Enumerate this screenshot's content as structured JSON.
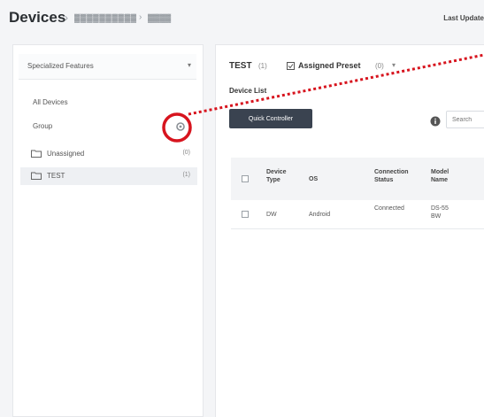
{
  "header": {
    "title": "Devices",
    "separator": "›",
    "breadcrumb": [
      "▓▓▓▓▓▓▓▓▓▓",
      "▓▓▓▓"
    ],
    "last_update": "Last Update"
  },
  "sidebar": {
    "feature_select": "Specialized Features",
    "nav_all": "All Devices",
    "nav_group": "Group",
    "groups": [
      {
        "label": "Unassigned",
        "count": "(0)"
      },
      {
        "label": "TEST",
        "count": "(1)"
      }
    ]
  },
  "main": {
    "group_title": "TEST",
    "group_count": "(1)",
    "preset_label": "Assigned Preset",
    "preset_count": "(0)",
    "device_list_label": "Device List",
    "quick_controller_label": "Quick Controller",
    "search_placeholder": "Search",
    "table": {
      "headers": [
        "Device Type",
        "OS",
        "Connection Status",
        "Model Name"
      ],
      "rows": [
        [
          "DW",
          "Android",
          "Connected",
          "DS-55 BW"
        ]
      ]
    }
  },
  "colors": {
    "annotation": "#d7141e",
    "button": "#3a4350"
  },
  "icons": {
    "group_settings": "gear-icon",
    "folder": "folder-icon",
    "preset": "preset-icon",
    "info": "info-icon"
  }
}
